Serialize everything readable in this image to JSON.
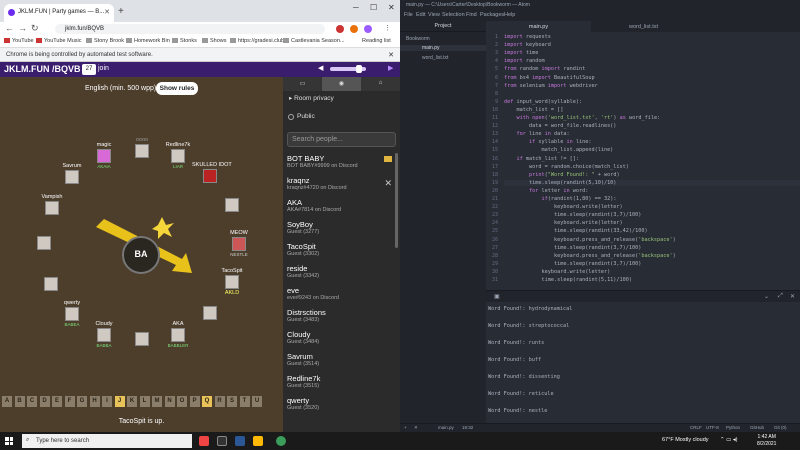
{
  "chrome": {
    "tab_title": "JKLM.FUN | Party games — B...",
    "url": "jklm.fun/BQVB",
    "bookmarks": [
      "YouTube",
      "YouTube Music",
      "Stony Brook",
      "Homework Bin",
      "Stonks",
      "Shows",
      "https://gradesi.club",
      "Castlevania Season..."
    ],
    "reading_list": "Reading list",
    "automation_msg": "Chrome is being controlled by automated test software."
  },
  "game": {
    "site_title": "JKLM.FUN /BQVB",
    "player_count": "27",
    "join_label": "join",
    "rules_text": "English (min. 500 wpp)",
    "rules_button": "Show rules",
    "bomb_syllable": "BA",
    "volume": 0.8,
    "turn_message": "TacoSpit is up.",
    "seats": [
      {
        "name": "magic",
        "word": "AKAIA"
      },
      {
        "name": "Redline7k",
        "word": "LIAR"
      },
      {
        "name": "Savrum",
        "word": ""
      },
      {
        "name": "SKULLED IDOT",
        "word": ""
      },
      {
        "name": "Vampish",
        "word": ""
      },
      {
        "name": "MEOW",
        "word": "NESTLE"
      },
      {
        "name": "TacoSpit",
        "word": "",
        "badge": "AKLD"
      },
      {
        "name": "qwerty",
        "word": "BABEA"
      },
      {
        "name": "Cloudy",
        "word": "BABBA"
      },
      {
        "name": "AKA",
        "word": "BABBLER"
      }
    ],
    "alphabet": [
      "A",
      "B",
      "C",
      "D",
      "E",
      "F",
      "G",
      "H",
      "I",
      "J",
      "K",
      "L",
      "M",
      "N",
      "O",
      "P",
      "Q",
      "R",
      "S",
      "T",
      "U"
    ],
    "alphabet_used": [
      "J",
      "Q"
    ]
  },
  "sidebar": {
    "room_privacy": "Room privacy",
    "public_label": "Public",
    "search_placeholder": "Search people...",
    "players": [
      {
        "name": "BOT BABY",
        "sub": "BOT BABY#9999 on Discord",
        "crown": true
      },
      {
        "name": "kraqnz",
        "sub": "kraqnz#4720 on Discord",
        "kick": true
      },
      {
        "name": "AKA",
        "sub": "AKA#7814 on Discord"
      },
      {
        "name": "SoyBoy",
        "sub": "Guest (3277)"
      },
      {
        "name": "TacoSpit",
        "sub": "Guest (3302)"
      },
      {
        "name": "reside",
        "sub": "Guest (3342)"
      },
      {
        "name": "eve",
        "sub": "eve#9243 on Discord"
      },
      {
        "name": "Distrsctions",
        "sub": "Guest (3483)"
      },
      {
        "name": "Cloudy",
        "sub": "Guest (3484)"
      },
      {
        "name": "Savrum",
        "sub": "Guest (3514)"
      },
      {
        "name": "Redline7k",
        "sub": "Guest (3515)"
      },
      {
        "name": "qwerty",
        "sub": "Guest (3520)"
      }
    ]
  },
  "atom": {
    "title": "main.py — C:\\Users\\Carter\\Desktop\\Bookworm — Atom",
    "menu": [
      "File",
      "Edit",
      "View",
      "Selection",
      "Find",
      "Packages",
      "Help"
    ],
    "tree_header": "Project",
    "tree": [
      "Bookworm",
      "main.py",
      "word_list.txt"
    ],
    "tabs": [
      "main.py",
      "word_list.txt"
    ],
    "code": [
      {
        "n": "1",
        "t": "import requests"
      },
      {
        "n": "2",
        "t": "import keyboard"
      },
      {
        "n": "3",
        "t": "import time"
      },
      {
        "n": "4",
        "t": "import random"
      },
      {
        "n": "5",
        "t": "from random import randint"
      },
      {
        "n": "6",
        "t": "from bs4 import BeautifulSoup"
      },
      {
        "n": "7",
        "t": "from selenium import webdriver"
      },
      {
        "n": "8",
        "t": ""
      },
      {
        "n": "9",
        "t": "def input_word(syllable):"
      },
      {
        "n": "10",
        "t": "    match_list = []"
      },
      {
        "n": "11",
        "t": "    with open('word_list.txt', 'rt') as word_file:"
      },
      {
        "n": "12",
        "t": "        data = word_file.readlines()"
      },
      {
        "n": "13",
        "t": "    for line in data:"
      },
      {
        "n": "14",
        "t": "        if syllable in line:"
      },
      {
        "n": "15",
        "t": "            match_list.append(line)"
      },
      {
        "n": "16",
        "t": "    if match_list != []:"
      },
      {
        "n": "17",
        "t": "        word = random.choice(match_list)"
      },
      {
        "n": "18",
        "t": "        print(\"Word Found!: \" + word)"
      },
      {
        "n": "19",
        "t": "        time.sleep(randint(5,10)/10)"
      },
      {
        "n": "20",
        "t": "        for letter in word:"
      },
      {
        "n": "21",
        "t": "            if(randint(1,80) == 32):"
      },
      {
        "n": "22",
        "t": "                keyboard.write(letter)"
      },
      {
        "n": "23",
        "t": "                time.sleep(randint(3,7)/100)"
      },
      {
        "n": "24",
        "t": "                keyboard.write(letter)"
      },
      {
        "n": "25",
        "t": "                time.sleep(randint(33,42)/100)"
      },
      {
        "n": "26",
        "t": "                keyboard.press_and_release('backspace')"
      },
      {
        "n": "27",
        "t": "                time.sleep(randint(3,7)/100)"
      },
      {
        "n": "28",
        "t": "                keyboard.press_and_release('backspace')"
      },
      {
        "n": "29",
        "t": "                time.sleep(randint(3,7)/100)"
      },
      {
        "n": "30",
        "t": "            keyboard.write(letter)"
      },
      {
        "n": "31",
        "t": "            time.sleep(randint(5,11)/100)"
      }
    ],
    "console": [
      "Word Found!: hydrodynamical",
      "Word Found!: streptococcal",
      "Word Found!: runts",
      "Word Found!: buff",
      "Word Found!: dissenting",
      "Word Found!: reticule",
      "Word Found!: nestle"
    ],
    "status": {
      "file": "main.py",
      "pos": "19:32",
      "eol": "CRLF",
      "enc": "UTF-8",
      "lang": "Python",
      "github": "GitHub",
      "git": "Git (0)"
    }
  },
  "taskbar": {
    "search": "Type here to search",
    "weather": "67°F  Mostly cloudy",
    "time": "1:42 AM",
    "date": "8/2/2021"
  }
}
